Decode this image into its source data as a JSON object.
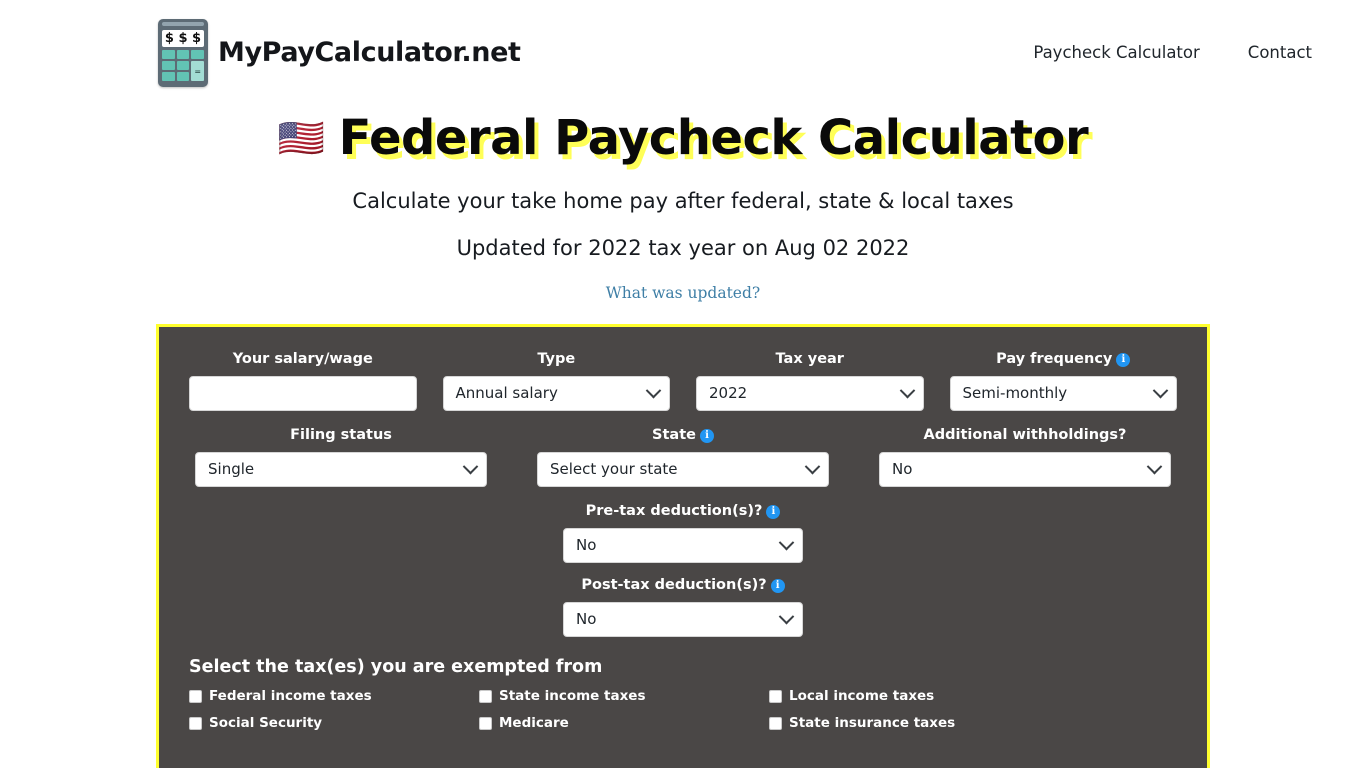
{
  "header": {
    "brand_name": "MyPayCalculator.net",
    "logo_display": "$ $ $",
    "logo_equals": "=",
    "nav": [
      {
        "label": "Paycheck Calculator"
      },
      {
        "label": "Contact"
      }
    ]
  },
  "hero": {
    "flag": "🇺🇸",
    "title": "Federal Paycheck Calculator",
    "subtitle": "Calculate your take home pay after federal, state & local taxes",
    "updated": "Updated for 2022 tax year on Aug 02 2022",
    "link": "What was updated?"
  },
  "calculator": {
    "row1": [
      {
        "label": "Your salary/wage",
        "type": "text",
        "value": "",
        "placeholder": "",
        "info": false
      },
      {
        "label": "Type",
        "type": "select",
        "value": "Annual salary",
        "info": false
      },
      {
        "label": "Tax year",
        "type": "select",
        "value": "2022",
        "info": false
      },
      {
        "label": "Pay frequency",
        "type": "select",
        "value": "Semi-monthly",
        "info": true
      }
    ],
    "row2": [
      {
        "label": "Filing status",
        "type": "select",
        "value": "Single",
        "info": false
      },
      {
        "label": "State",
        "type": "select",
        "value": "Select your state",
        "info": true
      },
      {
        "label": "Additional withholdings?",
        "type": "select",
        "value": "No",
        "info": false
      }
    ],
    "pretax": {
      "label": "Pre-tax deduction(s)?",
      "value": "No",
      "info": true
    },
    "posttax": {
      "label": "Post-tax deduction(s)?",
      "value": "No",
      "info": true
    },
    "exemptions": {
      "title": "Select the tax(es) you are exempted from",
      "items": [
        {
          "label": "Federal income taxes",
          "checked": false
        },
        {
          "label": "State income taxes",
          "checked": false
        },
        {
          "label": "Local income taxes",
          "checked": false
        },
        {
          "label": "Social Security",
          "checked": false
        },
        {
          "label": "Medicare",
          "checked": false
        },
        {
          "label": "State insurance taxes",
          "checked": false
        }
      ]
    },
    "info_icon_glyph": "i"
  },
  "colors": {
    "panel_bg": "#4a4746",
    "panel_border": "#ffff2e",
    "title_shadow": "#ffff57",
    "info_blue": "#2196f3",
    "link_blue": "#3f7fa6",
    "logo_teal": "#62c3b4"
  }
}
